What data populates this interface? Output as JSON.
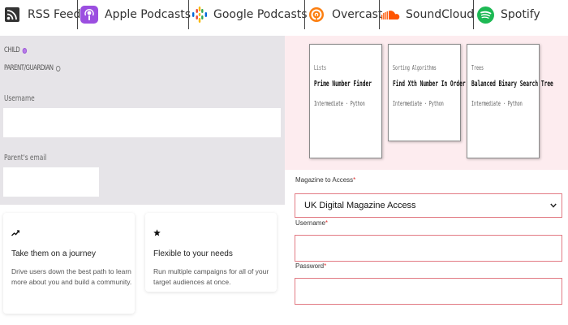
{
  "podcast_bar": {
    "items": [
      {
        "label": "RSS Feed",
        "icon": "rss-icon"
      },
      {
        "label": "Apple Podcasts",
        "icon": "apple-podcasts-icon"
      },
      {
        "label": "Google Podcasts",
        "icon": "google-podcasts-icon"
      },
      {
        "label": "Overcast",
        "icon": "overcast-icon"
      },
      {
        "label": "SoundCloud",
        "icon": "soundcloud-icon"
      },
      {
        "label": "Spotify",
        "icon": "spotify-icon"
      }
    ]
  },
  "signup": {
    "role_child": "CHILD",
    "role_parent": "PARENT/GUARDIAN",
    "selected_role": "CHILD",
    "username_label": "Username",
    "username_value": "",
    "parent_email_label": "Parent's email",
    "parent_email_value": ""
  },
  "features": [
    {
      "icon": "trend-up-icon",
      "title": "Take them on a journey",
      "desc": "Drive users down the best path to learn more about you and build a community."
    },
    {
      "icon": "star-icon",
      "title": "Flexible to your needs",
      "desc": "Run multiple campaigns for all of your target audiences at once."
    }
  ],
  "challenges": [
    {
      "category": "Lists",
      "title": "Prime Number Finder",
      "meta": "Intermediate · Python"
    },
    {
      "category": "Sorting Algorithms",
      "title": "Find Xth Number In Order",
      "meta": "Intermediate · Python"
    },
    {
      "category": "Trees",
      "title": "Balanced Binary Search Tree",
      "meta": "Intermediate · Python"
    }
  ],
  "magazine_form": {
    "magazine_label": "Magazine to Access",
    "required_mark": "*",
    "magazine_selected": "UK Digital Magazine Access",
    "username_label": "Username",
    "username_value": "",
    "password_label": "Password",
    "password_value": ""
  },
  "colors": {
    "radio_selected": "#b77be8",
    "form_border": "#e27b84",
    "required": "#dd3333",
    "pink_panel": "#fdecef",
    "grey_panel": "#e6e4e8",
    "apple_podcasts": "#9b4ee0",
    "soundcloud": "#ff5500",
    "spotify": "#1db954",
    "overcast": "#fc7e0f"
  }
}
